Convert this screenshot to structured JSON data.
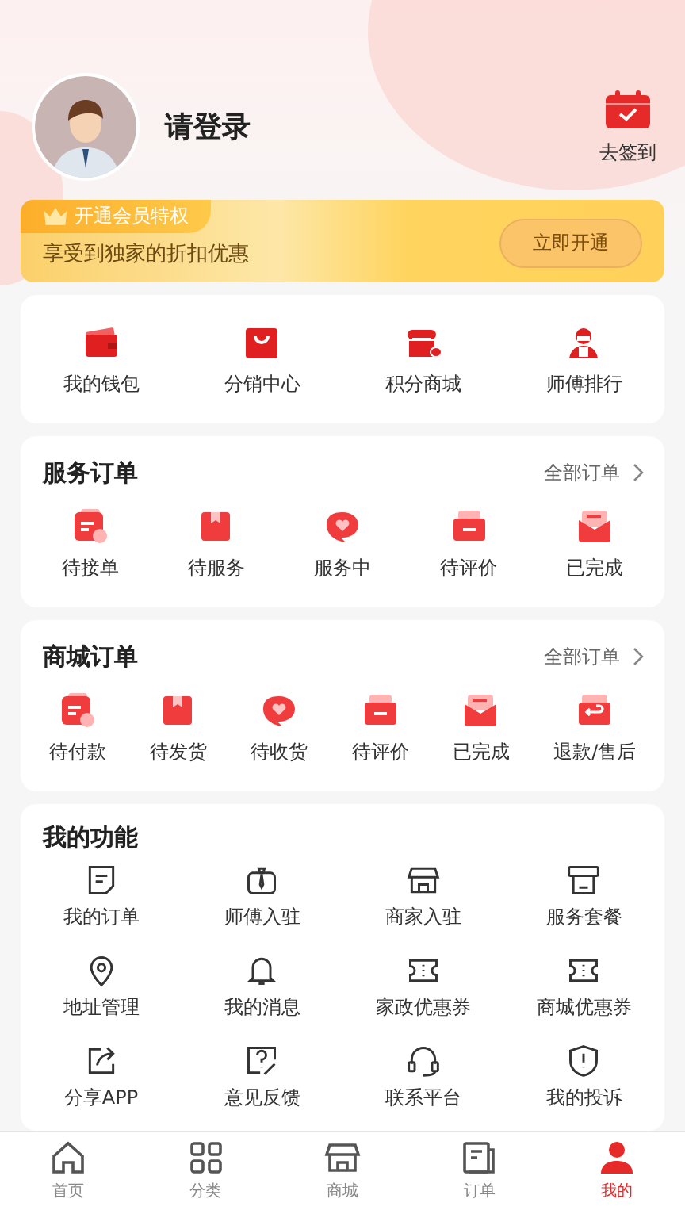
{
  "profile": {
    "name": "请登录",
    "checkin": "去签到"
  },
  "vip": {
    "badge": "开通会员特权",
    "text": "享受到独家的折扣优惠",
    "button": "立即开通"
  },
  "shortcuts": [
    "我的钱包",
    "分销中心",
    "积分商城",
    "师傅排行"
  ],
  "service_orders": {
    "title": "服务订单",
    "more": "全部订单",
    "items": [
      "待接单",
      "待服务",
      "服务中",
      "待评价",
      "已完成"
    ]
  },
  "mall_orders": {
    "title": "商城订单",
    "more": "全部订单",
    "items": [
      "待付款",
      "待发货",
      "待收货",
      "待评价",
      "已完成",
      "退款/售后"
    ]
  },
  "functions": {
    "title": "我的功能",
    "items": [
      "我的订单",
      "师傅入驻",
      "商家入驻",
      "服务套餐",
      "地址管理",
      "我的消息",
      "家政优惠券",
      "商城优惠券",
      "分享APP",
      "意见反馈",
      "联系平台",
      "我的投诉"
    ]
  },
  "tab_bar": [
    {
      "label": "首页",
      "selected": false
    },
    {
      "label": "分类",
      "selected": false
    },
    {
      "label": "商城",
      "selected": false
    },
    {
      "label": "订单",
      "selected": false
    },
    {
      "label": "我的",
      "selected": true
    }
  ]
}
